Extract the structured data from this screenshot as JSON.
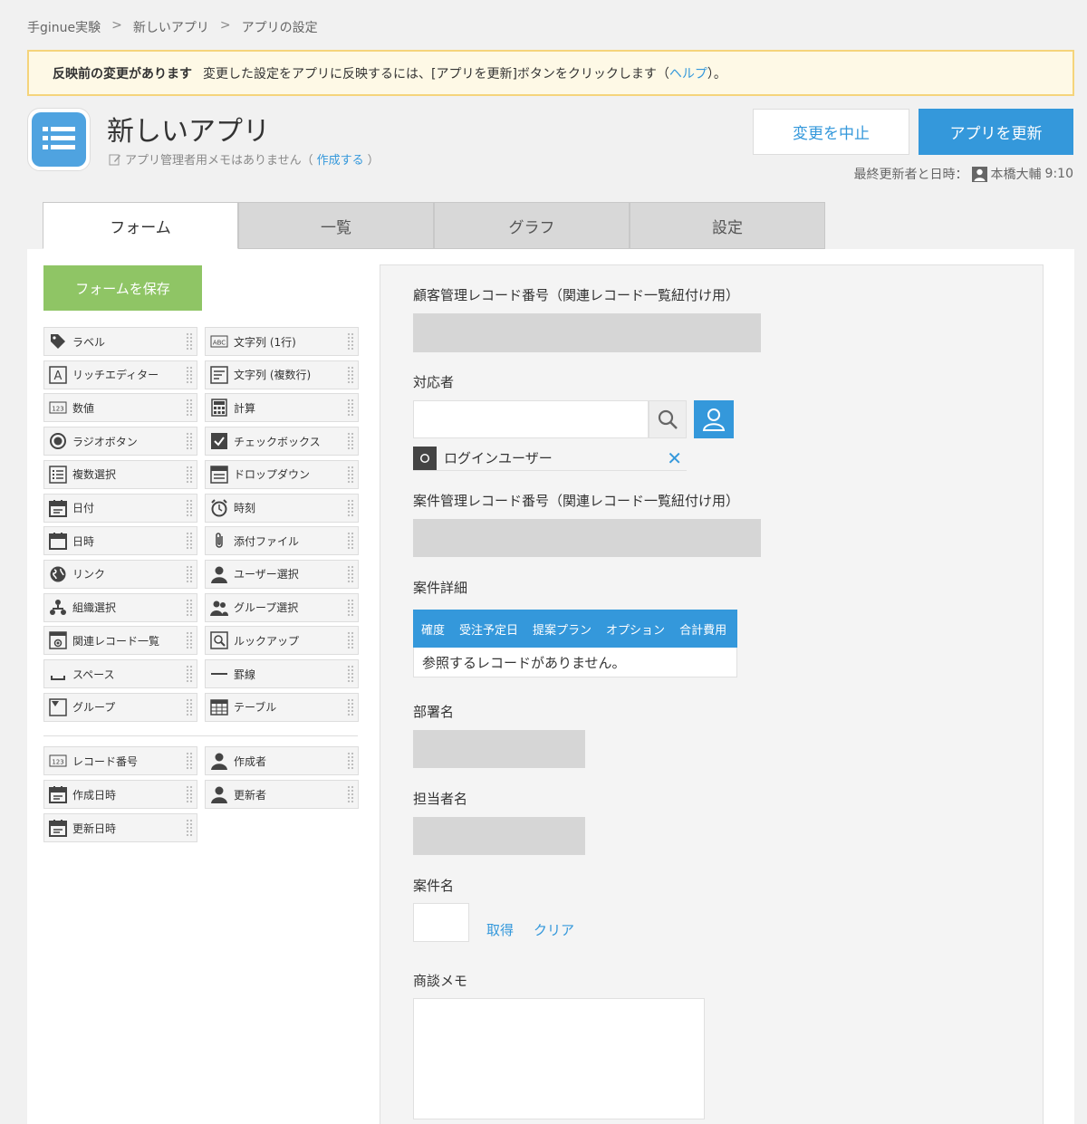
{
  "breadcrumb": [
    "手ginue実験",
    "新しいアプリ",
    "アプリの設定"
  ],
  "breadcrumb_sep": ">",
  "notice": {
    "title": "反映前の変更があります",
    "text": "変更した設定をアプリに反映するには、[アプリを更新]ボタンをクリックします（",
    "link": "ヘルプ",
    "suffix": "）。"
  },
  "app": {
    "title": "新しいアプリ",
    "memo_text": "アプリ管理者用メモはありません（",
    "memo_link": "作成する",
    "memo_suffix": "）"
  },
  "buttons": {
    "cancel": "変更を中止",
    "update": "アプリを更新",
    "save_form": "フォームを保存"
  },
  "last_updated": {
    "label": "最終更新者と日時：",
    "user": "本橋大輔",
    "time": "9:10"
  },
  "tabs": [
    {
      "label": "フォーム",
      "active": true
    },
    {
      "label": "一覧",
      "active": false
    },
    {
      "label": "グラフ",
      "active": false
    },
    {
      "label": "設定",
      "active": false
    }
  ],
  "palette": [
    {
      "label": "ラベル",
      "icon": "tag-icon"
    },
    {
      "label": "文字列 (1行)",
      "icon": "abc-icon"
    },
    {
      "label": "リッチエディター",
      "icon": "rich-text-icon"
    },
    {
      "label": "文字列 (複数行)",
      "icon": "multiline-icon"
    },
    {
      "label": "数値",
      "icon": "number-icon"
    },
    {
      "label": "計算",
      "icon": "calculator-icon"
    },
    {
      "label": "ラジオボタン",
      "icon": "radio-icon"
    },
    {
      "label": "チェックボックス",
      "icon": "checkbox-icon"
    },
    {
      "label": "複数選択",
      "icon": "multi-select-icon"
    },
    {
      "label": "ドロップダウン",
      "icon": "dropdown-icon"
    },
    {
      "label": "日付",
      "icon": "calendar-icon"
    },
    {
      "label": "時刻",
      "icon": "clock-icon"
    },
    {
      "label": "日時",
      "icon": "datetime-icon"
    },
    {
      "label": "添付ファイル",
      "icon": "paperclip-icon"
    },
    {
      "label": "リンク",
      "icon": "globe-icon"
    },
    {
      "label": "ユーザー選択",
      "icon": "user-icon"
    },
    {
      "label": "組織選択",
      "icon": "org-icon"
    },
    {
      "label": "グループ選択",
      "icon": "group-icon"
    },
    {
      "label": "関連レコード一覧",
      "icon": "related-records-icon"
    },
    {
      "label": "ルックアップ",
      "icon": "lookup-icon"
    },
    {
      "label": "スペース",
      "icon": "space-icon"
    },
    {
      "label": "罫線",
      "icon": "line-icon"
    },
    {
      "label": "グループ",
      "icon": "group-field-icon"
    },
    {
      "label": "テーブル",
      "icon": "table-icon"
    }
  ],
  "system_fields": [
    {
      "label": "レコード番号",
      "icon": "number-icon"
    },
    {
      "label": "作成者",
      "icon": "user-icon"
    },
    {
      "label": "作成日時",
      "icon": "calendar-icon"
    },
    {
      "label": "更新者",
      "icon": "user-icon"
    },
    {
      "label": "更新日時",
      "icon": "calendar-icon"
    }
  ],
  "form": {
    "customer_record_label": "顧客管理レコード番号（関連レコード一覧紐付け用）",
    "responder_label": "対応者",
    "login_user": "ログインユーザー",
    "project_record_label": "案件管理レコード番号（関連レコード一覧紐付け用）",
    "project_detail_label": "案件詳細",
    "subtable_columns": [
      "確度",
      "受注予定日",
      "提案プラン",
      "オプション",
      "合計費用"
    ],
    "subtable_empty": "参照するレコードがありません。",
    "department_label": "部署名",
    "person_label": "担当者名",
    "project_name_label": "案件名",
    "fetch_link": "取得",
    "clear_link": "クリア",
    "memo_label": "商談メモ"
  },
  "colors": {
    "accent": "#3498db",
    "save": "#8fc565",
    "notice_bg": "#fef9e6",
    "notice_border": "#f5d47b"
  }
}
